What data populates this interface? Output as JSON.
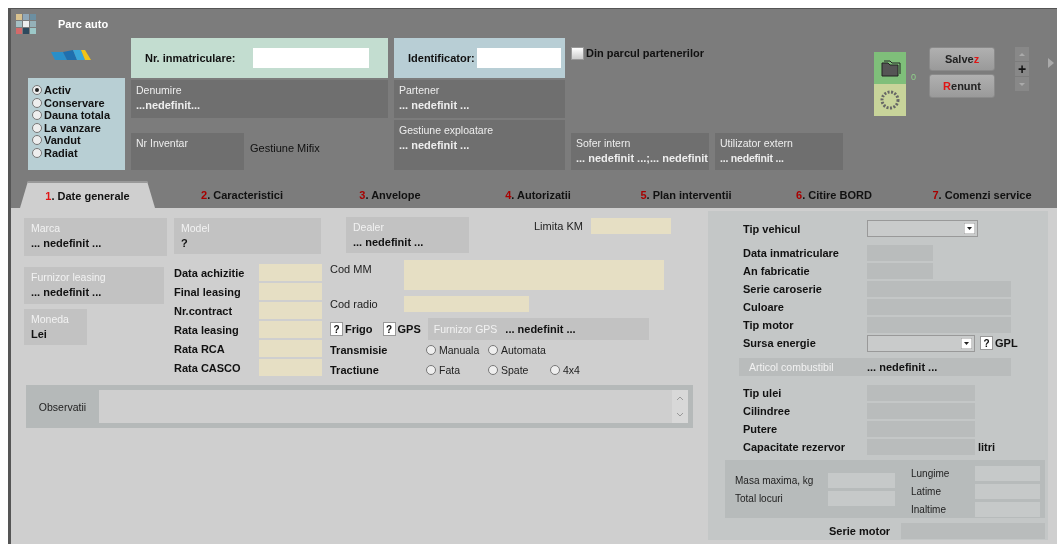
{
  "window": {
    "title": "Parc auto"
  },
  "status_options": [
    {
      "label": "Activ",
      "selected": true
    },
    {
      "label": "Conservare",
      "selected": false
    },
    {
      "label": "Dauna totala",
      "selected": false
    },
    {
      "label": "La vanzare",
      "selected": false
    },
    {
      "label": "Vandut",
      "selected": false
    },
    {
      "label": "Radiat",
      "selected": false
    }
  ],
  "registration": {
    "label": "Nr. inmatriculare:"
  },
  "identifier": {
    "label": "Identificator:"
  },
  "partner_fleet": {
    "label": "Din parcul partenerilor",
    "checked": false
  },
  "info_boxes": [
    {
      "label": "Denumire",
      "value": "...nedefinit..."
    },
    {
      "label": "Partener",
      "value": "... nedefinit ..."
    }
  ],
  "inventory": {
    "label": "Nr Inventar",
    "note": "Gestiune Mifix"
  },
  "assignment_boxes": [
    {
      "label": "Gestiune exploatare",
      "value": "... nedefinit ..."
    },
    {
      "label": "Sofer intern",
      "value": "... nedefinit ...;... nedefinit"
    },
    {
      "label": "Utilizator extern",
      "value": "... nedefinit ..."
    }
  ],
  "attachments_count": "0",
  "buttons": [
    {
      "parts": [
        {
          "text": "Salve",
          "hotkey": false
        },
        {
          "text": "z",
          "hotkey": true
        }
      ]
    },
    {
      "parts": [
        {
          "text": "R",
          "hotkey": true
        },
        {
          "text": "enunt",
          "hotkey": false
        }
      ]
    }
  ],
  "spin": {
    "label": "+"
  },
  "tabs": [
    {
      "parts": [
        {
          "text": "1",
          "hotkey": true
        },
        {
          "text": ". Date generale",
          "hotkey": false
        }
      ],
      "selected": true
    },
    {
      "parts": [
        {
          "text": "2",
          "hotkey": true
        },
        {
          "text": ". Caracteristici",
          "hotkey": false
        }
      ],
      "selected": false
    },
    {
      "parts": [
        {
          "text": "3",
          "hotkey": true
        },
        {
          "text": ". Anvelope",
          "hotkey": false
        }
      ],
      "selected": false
    },
    {
      "parts": [
        {
          "text": "4",
          "hotkey": true
        },
        {
          "text": ". Autorizatii",
          "hotkey": false
        }
      ],
      "selected": false
    },
    {
      "parts": [
        {
          "text": "5",
          "hotkey": true
        },
        {
          "text": ". Plan interventii",
          "hotkey": false
        }
      ],
      "selected": false
    },
    {
      "parts": [
        {
          "text": "6",
          "hotkey": true
        },
        {
          "text": ". Citire BORD",
          "hotkey": false
        }
      ],
      "selected": false
    },
    {
      "parts": [
        {
          "text": "7",
          "hotkey": true
        },
        {
          "text": ". Comenzi service",
          "hotkey": false
        }
      ],
      "selected": false
    }
  ],
  "general": {
    "brand": {
      "label": "Marca",
      "value": "... nedefinit ..."
    },
    "leasing_supplier": {
      "label": "Furnizor leasing",
      "value": "... nedefinit ..."
    },
    "currency": {
      "label": "Moneda",
      "value": "Lei"
    },
    "model": {
      "label": "Model",
      "value": "?"
    },
    "date_fields": [
      {
        "label": "Data achizitie"
      },
      {
        "label": "Final leasing"
      },
      {
        "label": "Nr.contract"
      },
      {
        "label": "Rata leasing"
      },
      {
        "label": "Rata RCA"
      },
      {
        "label": "Rata CASCO"
      }
    ],
    "dealer": {
      "label": "Dealer",
      "value": "... nedefinit ..."
    },
    "km_limit": {
      "label": "Limita KM"
    },
    "mm_code": {
      "label": "Cod MM"
    },
    "radio_code": {
      "label": "Cod radio"
    },
    "flags": [
      {
        "label": "Frigo",
        "state": "?"
      },
      {
        "label": "GPS",
        "state": "?"
      }
    ],
    "gps_supplier": {
      "label": "Furnizor GPS",
      "value": "... nedefinit ..."
    },
    "option_rows": [
      {
        "label": "Transmisie",
        "options": [
          {
            "label": "Manuala",
            "selected": false
          },
          {
            "label": "Automata",
            "selected": false
          }
        ]
      },
      {
        "label": "Tractiune",
        "options": [
          {
            "label": "Fata",
            "selected": false
          },
          {
            "label": "Spate",
            "selected": false
          },
          {
            "label": "4x4",
            "selected": false
          }
        ]
      }
    ],
    "notes": {
      "label": "Observatii"
    }
  },
  "vehicle": {
    "type": {
      "label": "Tip vehicul"
    },
    "fields": [
      {
        "label": "Data inmatriculare",
        "kind": "short"
      },
      {
        "label": "An fabricatie",
        "kind": "short"
      },
      {
        "label": "Serie caroserie",
        "kind": "long"
      },
      {
        "label": "Culoare",
        "kind": "long"
      },
      {
        "label": "Tip motor",
        "kind": "long"
      }
    ],
    "energy": {
      "label": "Sursa energie",
      "flag_state": "?",
      "flag_label": "GPL"
    },
    "fuel_item": {
      "label": "Articol combustibil",
      "value": "... nedefinit ..."
    },
    "engine_fields": [
      {
        "label": "Tip ulei"
      },
      {
        "label": "Cilindree"
      },
      {
        "label": "Putere"
      },
      {
        "label": "Capacitate rezervor",
        "unit": "litri"
      }
    ],
    "mass_fields": [
      {
        "label": "Masa maxima, kg"
      },
      {
        "label": "Total locuri"
      }
    ],
    "dimension_fields": [
      {
        "label": "Lungime"
      },
      {
        "label": "Latime"
      },
      {
        "label": "Inaltime"
      }
    ],
    "engine_serial": {
      "label": "Serie motor"
    }
  }
}
